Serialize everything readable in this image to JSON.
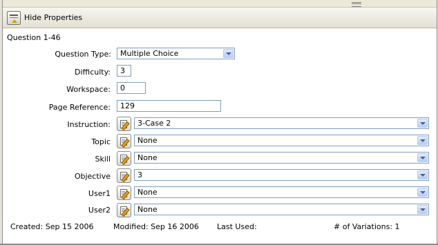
{
  "toolbar": {
    "hide_properties_label": "Hide Properties"
  },
  "question": {
    "title": "Question  1-46"
  },
  "fields": {
    "question_type": {
      "label": "Question Type:",
      "value": "Multiple Choice"
    },
    "difficulty": {
      "label": "Difficulty:",
      "value": "3"
    },
    "workspace": {
      "label": "Workspace:",
      "value": "0"
    },
    "page_reference": {
      "label": "Page Reference:",
      "value": "129"
    },
    "instruction": {
      "label": "Instruction:",
      "value": "3-Case 2"
    },
    "topic": {
      "label": "Topic",
      "value": "None"
    },
    "skill": {
      "label": "Skill",
      "value": "None"
    },
    "objective": {
      "label": "Objective",
      "value": "3"
    },
    "user1": {
      "label": "User1",
      "value": "None"
    },
    "user2": {
      "label": "User2",
      "value": "None"
    }
  },
  "footer": {
    "created": "Created:  Sep 15 2006",
    "modified": "Modified:  Sep 16 2006",
    "last_used": "Last Used:",
    "variations": "# of Variations: 1"
  },
  "icons": {
    "toolbar": "hide-properties-icon",
    "edit": "edit-icon",
    "dropdown": "chevron-down-icon"
  }
}
